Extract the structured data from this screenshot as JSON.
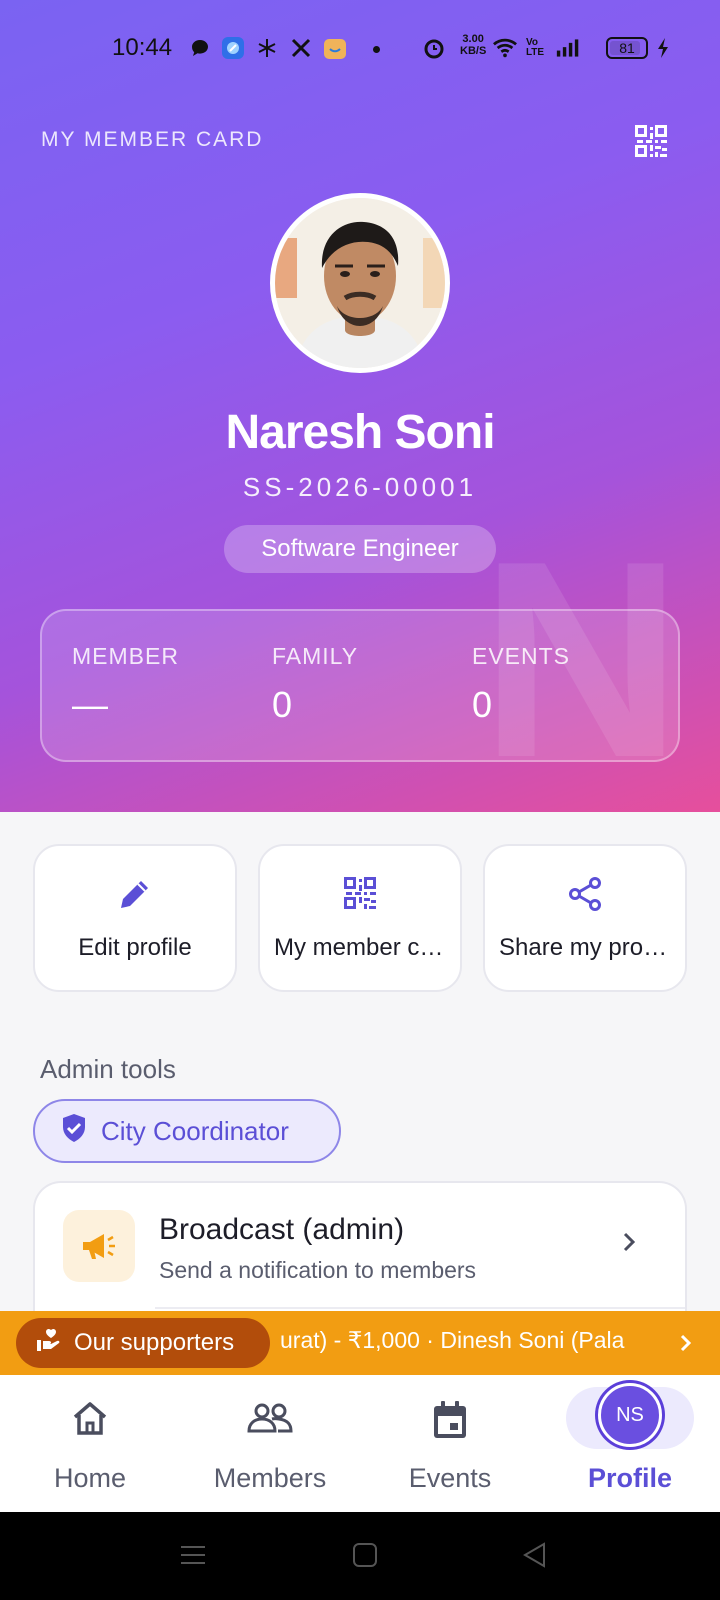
{
  "status_bar": {
    "time": "10:44",
    "net_speed": "3.00",
    "net_unit": "KB/S",
    "volte": "Vo LTE",
    "battery": "81"
  },
  "header": {
    "card_title": "MY MEMBER CARD",
    "qr_icon": "qr-code-icon"
  },
  "profile": {
    "name": "Naresh Soni",
    "member_id": "SS-2026-00001",
    "role": "Software Engineer",
    "watermark_letter": "N"
  },
  "stats": [
    {
      "label": "MEMBER",
      "value": "—"
    },
    {
      "label": "FAMILY",
      "value": "0"
    },
    {
      "label": "EVENTS",
      "value": "0"
    }
  ],
  "actions": [
    {
      "label": "Edit profile",
      "icon": "pencil-icon"
    },
    {
      "label": "My member card",
      "icon": "qr-code-icon"
    },
    {
      "label": "Share my profile",
      "icon": "share-icon"
    }
  ],
  "admin": {
    "section_title": "Admin tools",
    "badge": "City Coordinator",
    "items": [
      {
        "title": "Broadcast (admin)",
        "subtitle": "Send a notification to members",
        "icon": "megaphone-icon"
      }
    ]
  },
  "supporters": {
    "button": "Our supporters",
    "ticker": "urat) - ₹1,000 · Dinesh Soni (Pala"
  },
  "bottom_nav": [
    {
      "label": "Home",
      "icon": "home-icon"
    },
    {
      "label": "Members",
      "icon": "people-icon"
    },
    {
      "label": "Events",
      "icon": "calendar-icon"
    },
    {
      "label": "Profile",
      "initials": "NS",
      "active": true
    }
  ],
  "colors": {
    "accent": "#5b4fd6",
    "gradient_start": "#7a63f2",
    "gradient_end": "#e64f9c",
    "supporters_bar": "#f29d12",
    "supporters_pill": "#b24d0b"
  }
}
